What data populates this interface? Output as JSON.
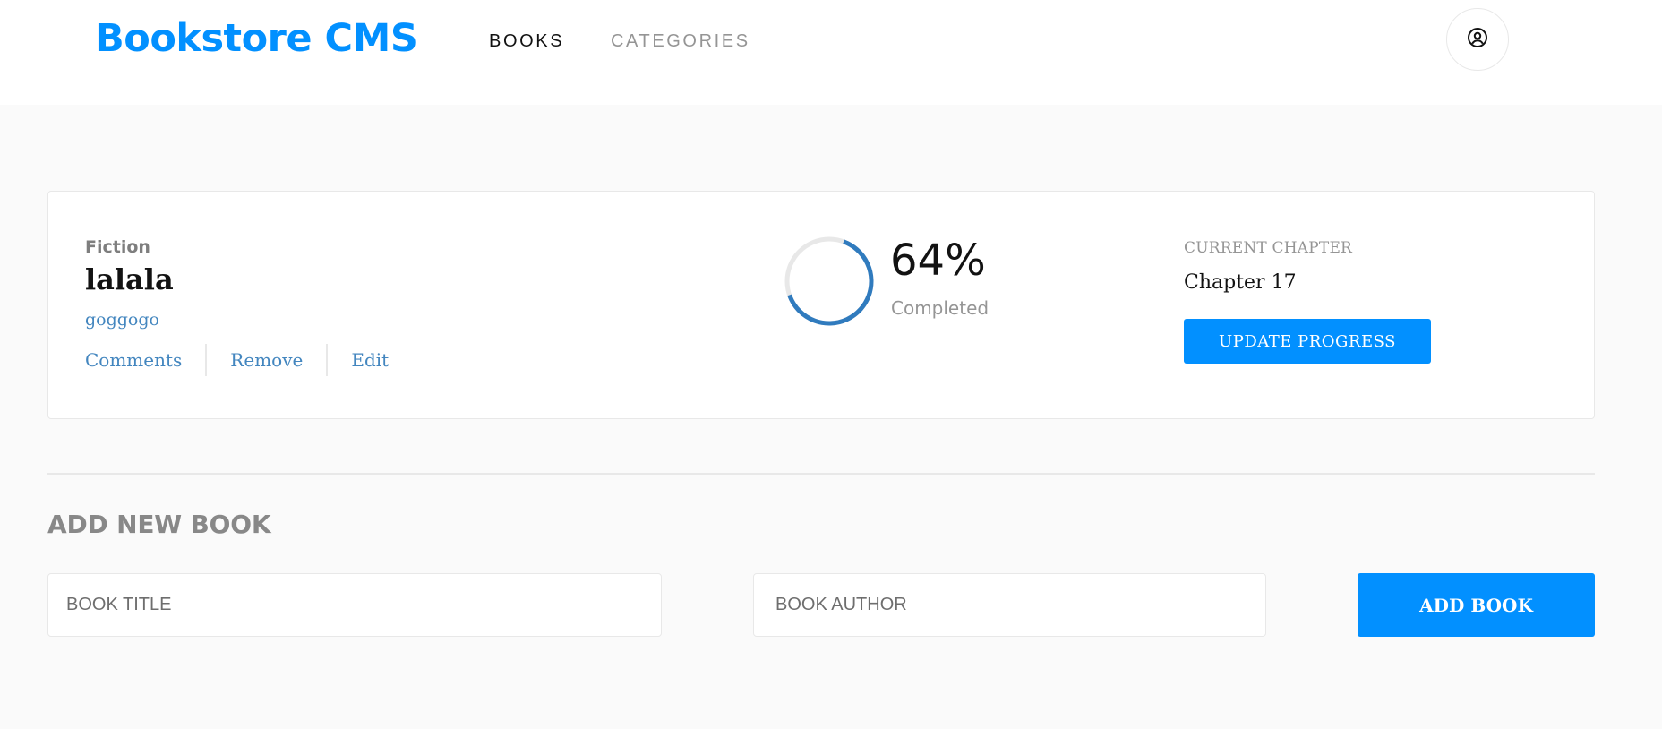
{
  "header": {
    "logo": "Bookstore CMS",
    "nav": [
      {
        "label": "BOOKS",
        "active": true
      },
      {
        "label": "CATEGORIES",
        "active": false
      }
    ],
    "user_icon": "user-circle-icon"
  },
  "book": {
    "category": "Fiction",
    "title": "lalala",
    "author": "goggogo",
    "actions": [
      "Comments",
      "Remove",
      "Edit"
    ],
    "progress": {
      "percent": 64,
      "percent_label": "64%",
      "completed_label": "Completed"
    },
    "current_chapter_label": "CURRENT CHAPTER",
    "current_chapter": "Chapter 17",
    "update_button": "UPDATE PROGRESS"
  },
  "form": {
    "heading": "ADD NEW BOOK",
    "title_placeholder": "BOOK TITLE",
    "author_placeholder": "BOOK AUTHOR",
    "submit_label": "ADD BOOK"
  },
  "colors": {
    "accent": "#0290ff",
    "link": "#4386bf",
    "progress": "#307bbe",
    "progress_track": "#e8e8e8"
  }
}
